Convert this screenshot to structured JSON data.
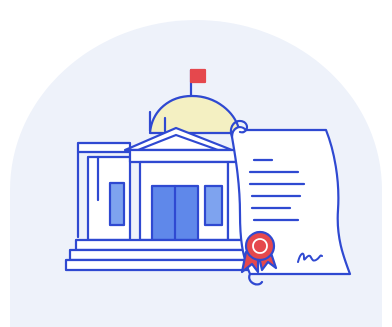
{
  "colors": {
    "background": "#ffffff",
    "panel": "#eef2fa",
    "outline": "#2f49d1",
    "building_white": "#ffffff",
    "dome_yellow": "#f4f0c2",
    "window_blue": "#7ea3ef",
    "door_blue": "#5f88ea",
    "flag_red": "#e5484d",
    "seal_red": "#e5484d",
    "scroll_white": "#ffffff"
  },
  "icons": {
    "building": "government-building-icon",
    "certificate": "certificate-scroll-icon",
    "seal": "wax-seal-icon",
    "signature": "signature-icon",
    "flag": "flag-icon"
  }
}
